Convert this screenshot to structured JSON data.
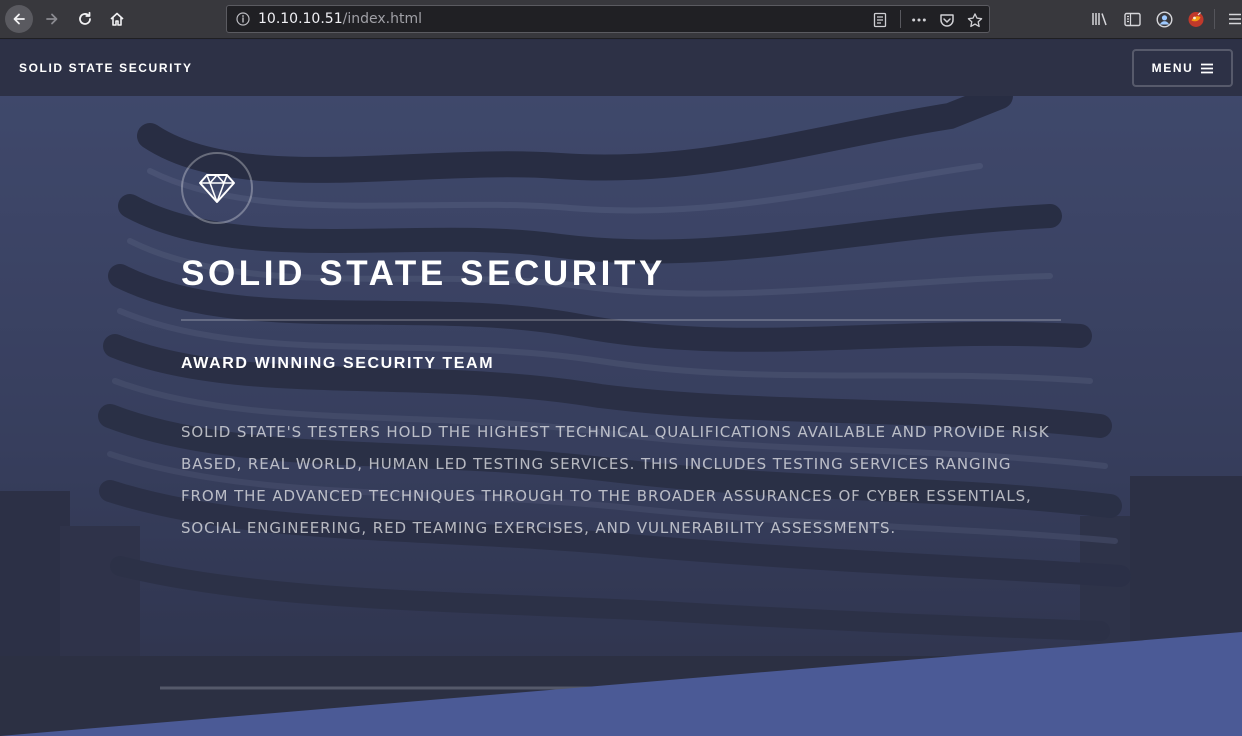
{
  "browser": {
    "url_host": "10.10.10.51",
    "url_path": "/index.html"
  },
  "site": {
    "logo": "SOLID STATE SECURITY",
    "menu_label": "MENU"
  },
  "banner": {
    "title": "SOLID STATE SECURITY",
    "subtitle": "AWARD WINNING SECURITY TEAM",
    "body": "SOLID STATE'S TESTERS HOLD THE HIGHEST TECHNICAL QUALIFICATIONS AVAILABLE AND PROVIDE RISK BASED, REAL WORLD, HUMAN LED TESTING SERVICES. THIS INCLUDES TESTING SERVICES RANGING FROM THE ADVANCED TECHNIQUES THROUGH TO THE BROADER ASSURANCES OF CYBER ESSENTIALS, SOCIAL ENGINEERING, RED TEAMING EXERCISES, AND VULNERABILITY ASSESSMENTS."
  },
  "icons": {
    "back": "arrow-left-icon",
    "forward": "arrow-right-icon",
    "reload": "reload-icon",
    "home": "home-icon",
    "info": "info-icon",
    "reader": "reader-view-icon",
    "more": "more-actions-icon",
    "pocket": "pocket-icon",
    "bookmark": "star-icon",
    "library": "library-icon",
    "sidebar": "sidebar-icon",
    "account": "account-icon",
    "extension": "extension-icon",
    "app_menu": "hamburger-icon",
    "site_menu": "bars-icon",
    "banner_logo": "diamond-icon"
  },
  "colors": {
    "header_bg": "#2d3146",
    "banner_overlay": "#363c55",
    "accent_wedge": "#4b5a96",
    "browser_bar": "#38383d"
  }
}
